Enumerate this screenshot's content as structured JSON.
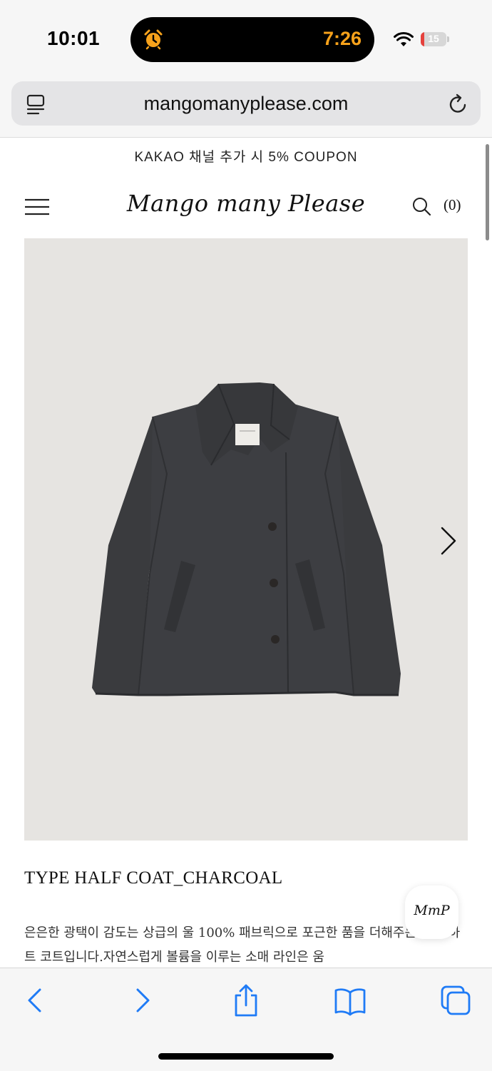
{
  "status_bar": {
    "time": "10:01",
    "timer": "7:26",
    "battery_level": "15",
    "battery_fraction": 0.15,
    "colors": {
      "timer": "#f7a21b",
      "battery_low": "#e5413c"
    },
    "icons": [
      "alarm-clock-icon",
      "wifi-icon",
      "battery-charging-icon"
    ]
  },
  "browser": {
    "url": "mangomanyplease.com",
    "icons": [
      "tabs-icon",
      "reload-icon"
    ]
  },
  "site": {
    "promo": "KAKAO 채널 추가 시 5% COUPON",
    "logo": "Mango many Please",
    "cart_count": "(0)",
    "icons": [
      "hamburger-menu-icon",
      "search-icon"
    ]
  },
  "product": {
    "title": "TYPE HALF COAT_CHARCOAL",
    "description": "은은한 광택이 감도는 상급의 울 100% 패브릭으로 포근한 품을 더해주는 타입 하트 코트입니다.자연스럽게 볼륨을 이루는 소매 라인은 움",
    "image_alt": "charcoal wool half coat",
    "floating_logo": "MmP",
    "colors": {
      "image_bg": "#e6e4e1",
      "coat": "#3a3b3e"
    }
  },
  "toolbar": {
    "icons": [
      "back-icon",
      "forward-icon",
      "share-icon",
      "bookmarks-icon",
      "tabs-overview-icon"
    ],
    "accent": "#1f7bf6"
  }
}
